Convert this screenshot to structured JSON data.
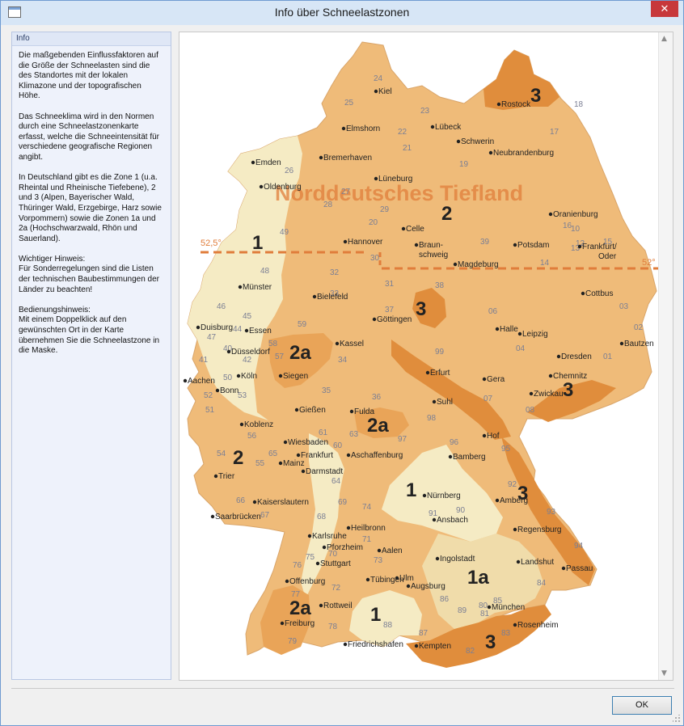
{
  "window": {
    "title": "Info über Schneelastzonen",
    "close_symbol": "✕",
    "app_icon": "window-icon"
  },
  "info": {
    "header": "Info",
    "text": "Die maßgebenden Einflussfaktoren auf die Größe der Schneelasten sind die des Standortes mit der lokalen Klimazone und der topografischen Höhe.\n\nDas Schneeklima wird in den Normen durch eine Schneelastzonenkarte erfasst, welche die Schneeintensität für verschiedene geografische Regionen angibt.\n\nIn Deutschland gibt es die Zone 1 (u.a. Rheintal und Rheinische Tiefebene), 2 und 3 (Alpen, Bayerischer Wald, Thüringer Wald, Erzgebirge, Harz sowie Vorpommern) sowie die Zonen 1a und 2a (Hochschwarzwald, Rhön und Sauerland).\n\nWichtiger Hinweis:\nFür Sonderregelungen sind die Listen der technischen Baubestimmungen der Länder zu beachten!\n\nBedienungshinweis:\nMit einem Doppelklick auf den gewünschten Ort in der Karte übernehmen Sie die Schneelastzone in die Maske."
  },
  "map": {
    "region_label": "Norddeutsches Tiefland",
    "lat_left": "52,5°",
    "lat_right": "52°",
    "colors": {
      "zone1": "#f5ebc4",
      "zone1a": "#f0dcaa",
      "zone2": "#efbb79",
      "zone2a": "#e9a458",
      "zone3": "#e08d3c",
      "line": "#e07d3b"
    },
    "zones": [
      {
        "label": "1"
      },
      {
        "label": "2"
      },
      {
        "label": "3"
      },
      {
        "label": "3"
      },
      {
        "label": "2a"
      },
      {
        "label": "2a"
      },
      {
        "label": "2"
      },
      {
        "label": "3"
      },
      {
        "label": "3"
      },
      {
        "label": "1"
      },
      {
        "label": "1a"
      },
      {
        "label": "2a"
      },
      {
        "label": "1"
      },
      {
        "label": "3"
      }
    ],
    "cities": [
      {
        "name": "Kiel"
      },
      {
        "name": "Rostock"
      },
      {
        "name": "Elmshorn"
      },
      {
        "name": "Lübeck"
      },
      {
        "name": "Schwerin"
      },
      {
        "name": "Neubrandenburg"
      },
      {
        "name": "Bremerhaven"
      },
      {
        "name": "Emden"
      },
      {
        "name": "Oldenburg"
      },
      {
        "name": "Lüneburg"
      },
      {
        "name": "Oranienburg"
      },
      {
        "name": "Celle"
      },
      {
        "name": "Hannover"
      },
      {
        "name": "Braun-"
      },
      {
        "name": "schweig"
      },
      {
        "name": "Potsdam"
      },
      {
        "name": "Frankfurt/"
      },
      {
        "name": "Oder"
      },
      {
        "name": "Magdeburg"
      },
      {
        "name": "Münster"
      },
      {
        "name": "Bielefeld"
      },
      {
        "name": "Cottbus"
      },
      {
        "name": "Duisburg"
      },
      {
        "name": "Essen"
      },
      {
        "name": "Göttingen"
      },
      {
        "name": "Halle"
      },
      {
        "name": "Leipzig"
      },
      {
        "name": "Kassel"
      },
      {
        "name": "Düsseldorf"
      },
      {
        "name": "Bautzen"
      },
      {
        "name": "Dresden"
      },
      {
        "name": "Köln"
      },
      {
        "name": "Siegen"
      },
      {
        "name": "Erfurt"
      },
      {
        "name": "Aachen"
      },
      {
        "name": "Bonn"
      },
      {
        "name": "Chemnitz"
      },
      {
        "name": "Gera"
      },
      {
        "name": "Zwickau"
      },
      {
        "name": "Suhl"
      },
      {
        "name": "Gießen"
      },
      {
        "name": "Fulda"
      },
      {
        "name": "Koblenz"
      },
      {
        "name": "Hof"
      },
      {
        "name": "Wiesbaden"
      },
      {
        "name": "Frankfurt"
      },
      {
        "name": "Aschaffenburg"
      },
      {
        "name": "Bamberg"
      },
      {
        "name": "Mainz"
      },
      {
        "name": "Darmstadt"
      },
      {
        "name": "Trier"
      },
      {
        "name": "Nürnberg"
      },
      {
        "name": "Kaiserslautern"
      },
      {
        "name": "Ansbach"
      },
      {
        "name": "Amberg"
      },
      {
        "name": "Saarbrücken"
      },
      {
        "name": "Heilbronn"
      },
      {
        "name": "Regensburg"
      },
      {
        "name": "Karlsruhe"
      },
      {
        "name": "Pforzheim"
      },
      {
        "name": "Aalen"
      },
      {
        "name": "Ingolstadt"
      },
      {
        "name": "Landshut"
      },
      {
        "name": "Stuttgart"
      },
      {
        "name": "Passau"
      },
      {
        "name": "Offenburg"
      },
      {
        "name": "Tübingen"
      },
      {
        "name": "Ulm"
      },
      {
        "name": "Augsburg"
      },
      {
        "name": "Rottweil"
      },
      {
        "name": "München"
      },
      {
        "name": "Freiburg"
      },
      {
        "name": "Rosenheim"
      },
      {
        "name": "Friedrichshafen"
      },
      {
        "name": "Kempten"
      }
    ],
    "postcodes": [
      "24",
      "25",
      "23",
      "18",
      "17",
      "26",
      "22",
      "21",
      "19",
      "27",
      "28",
      "29",
      "16",
      "20",
      "49",
      "48",
      "30",
      "31",
      "38",
      "39",
      "10",
      "12",
      "15",
      "13",
      "14",
      "32",
      "33",
      "37",
      "06",
      "03",
      "46",
      "45",
      "44",
      "59",
      "04",
      "47",
      "40",
      "42",
      "58",
      "34",
      "99",
      "41",
      "50",
      "57",
      "35",
      "07",
      "08",
      "02",
      "01",
      "36",
      "98",
      "52",
      "53",
      "51",
      "56",
      "61",
      "60",
      "63",
      "97",
      "96",
      "95",
      "54",
      "55",
      "65",
      "64",
      "69",
      "74",
      "90",
      "91",
      "92",
      "93",
      "66",
      "67",
      "68",
      "76",
      "75",
      "71",
      "73",
      "70",
      "72",
      "86",
      "89",
      "85",
      "84",
      "94",
      "77",
      "80",
      "81",
      "78",
      "88",
      "87",
      "83",
      "82",
      "79"
    ]
  },
  "buttons": {
    "ok": "OK"
  },
  "scroll": {
    "up": "▲",
    "down": "▼"
  }
}
